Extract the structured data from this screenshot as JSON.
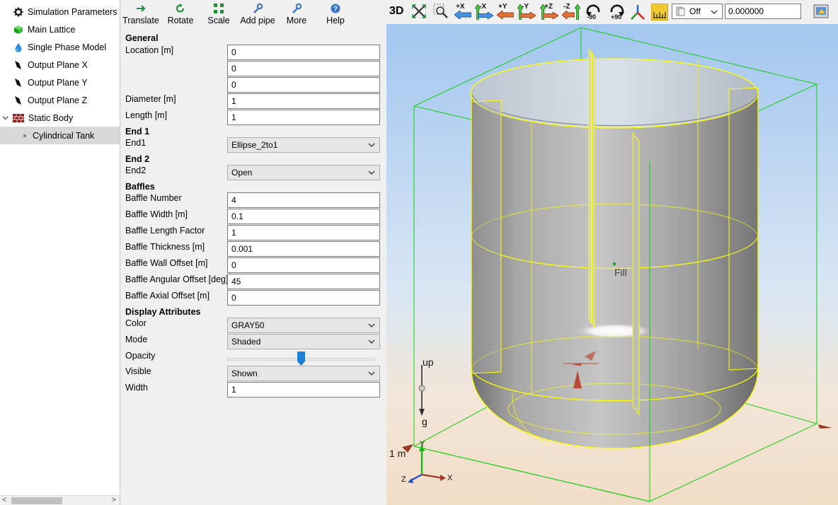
{
  "tree": {
    "items": [
      {
        "label": "Simulation Parameters",
        "icon": "gear-icon"
      },
      {
        "label": "Main Lattice",
        "icon": "cube-icon"
      },
      {
        "label": "Single Phase Model",
        "icon": "droplet-icon"
      },
      {
        "label": "Output Plane X",
        "icon": "plane-icon"
      },
      {
        "label": "Output Plane Y",
        "icon": "plane-icon"
      },
      {
        "label": "Output Plane Z",
        "icon": "plane-icon"
      },
      {
        "label": "Static Body",
        "icon": "brick-icon"
      },
      {
        "label": "Cylindrical Tank",
        "icon": "dot-icon"
      }
    ],
    "scroll_left": "<",
    "scroll_right": ">"
  },
  "toolbar": {
    "translate": "Translate",
    "rotate": "Rotate",
    "scale": "Scale",
    "add_pipe": "Add pipe",
    "more": "More",
    "help": "Help"
  },
  "props": {
    "general": "General",
    "location_label": "Location [m]",
    "location": [
      "0",
      "0",
      "0"
    ],
    "diameter_label": "Diameter [m]",
    "diameter": "1",
    "length_label": "Length [m]",
    "length": "1",
    "end1_header": "End 1",
    "end1_label": "End1",
    "end1": "Ellipse_2to1",
    "end2_header": "End 2",
    "end2_label": "End2",
    "end2": "Open",
    "baffles": "Baffles",
    "baffle_number_label": "Baffle Number",
    "baffle_number": "4",
    "baffle_width_label": "Baffle Width [m]",
    "baffle_width": "0.1",
    "baffle_length_label": "Baffle Length Factor",
    "baffle_length": "1",
    "baffle_thickness_label": "Baffle Thickness [m]",
    "baffle_thickness": "0.001",
    "baffle_wall_label": "Baffle Wall Offset [m]",
    "baffle_wall": "0",
    "baffle_angular_label": "Baffle Angular Offset [deg]",
    "baffle_angular": "45",
    "baffle_axial_label": "Baffle Axial Offset [m]",
    "baffle_axial": "0",
    "display": "Display Attributes",
    "color_label": "Color",
    "color": "GRAY50",
    "mode_label": "Mode",
    "mode": "Shaded",
    "opacity_label": "Opacity",
    "opacity": 0.5,
    "visible_label": "Visible",
    "visible": "Shown",
    "width_label": "Width",
    "width": "1"
  },
  "viewport": {
    "btn_3d": "3D",
    "view_px": "+X",
    "view_mx": "-X",
    "view_py": "+Y",
    "view_my": "-Y",
    "view_pz": "+Z",
    "view_mz": "-Z",
    "rot_m90": "-90",
    "rot_p90": "+90",
    "off_value": "Off",
    "numeric_value": "0.000000",
    "fill_label": "Fill",
    "gravity_up": "up",
    "gravity_g": "g",
    "scale_label": "1 m",
    "axis_x": "X",
    "axis_y": "Y",
    "axis_z": "Z"
  },
  "colors": {
    "sky_top": "#a9cbf0",
    "ground": "#f3e0cc",
    "bbox": "#00d000",
    "outline": "#ffff00",
    "tank": "#9a9a9a",
    "accent": "#1e7fd6"
  }
}
